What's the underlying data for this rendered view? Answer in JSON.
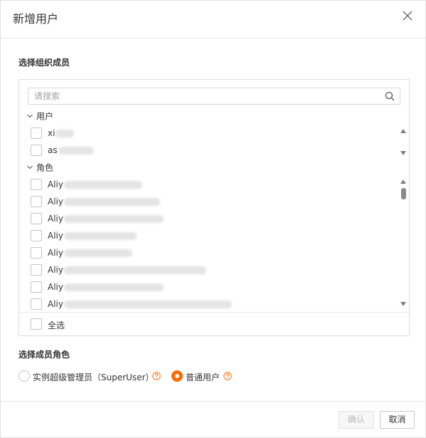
{
  "dialog": {
    "title": "新增用户",
    "close_icon": "close-icon"
  },
  "members": {
    "section_label": "选择组织成员",
    "search": {
      "placeholder": "请搜索",
      "value": "",
      "icon": "search-icon"
    },
    "groups": [
      {
        "label": "用户",
        "expanded": true,
        "items": [
          {
            "visible_text": "xi",
            "checked": false
          },
          {
            "visible_text": "as",
            "checked": false
          }
        ]
      },
      {
        "label": "角色",
        "expanded": true,
        "items": [
          {
            "visible_text": "Aliy",
            "checked": false
          },
          {
            "visible_text": "Aliy",
            "checked": false
          },
          {
            "visible_text": "Aliy",
            "checked": false
          },
          {
            "visible_text": "Aliy",
            "checked": false
          },
          {
            "visible_text": "Aliy",
            "checked": false
          },
          {
            "visible_text": "Aliy",
            "checked": false
          },
          {
            "visible_text": "Aliy",
            "checked": false
          },
          {
            "visible_text": "Aliy",
            "checked": false
          }
        ]
      }
    ],
    "select_all": {
      "label": "全选",
      "checked": false
    }
  },
  "role": {
    "section_label": "选择成员角色",
    "options": [
      {
        "label": "实例超级管理员（SuperUser）",
        "selected": false,
        "help_icon": "question-circle-icon"
      },
      {
        "label": "普通用户",
        "selected": true,
        "help_icon": "question-circle-icon"
      }
    ]
  },
  "footer": {
    "confirm_label": "确认",
    "confirm_disabled": true,
    "cancel_label": "取消"
  },
  "colors": {
    "accent": "#ff6a00",
    "border": "#dcdcdc",
    "text": "#333333",
    "disabled_text": "#bbbbbb"
  }
}
